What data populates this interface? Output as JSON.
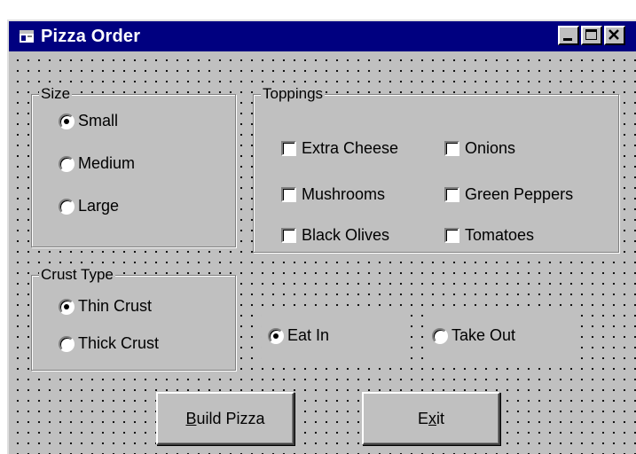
{
  "window": {
    "title": "Pizza Order",
    "icon": "form-icon",
    "controls": [
      "minimize-button",
      "maximize-button",
      "close-button"
    ]
  },
  "size_frame": {
    "label": "Size",
    "options": [
      {
        "label": "Small",
        "selected": true
      },
      {
        "label": "Medium",
        "selected": false
      },
      {
        "label": "Large",
        "selected": false
      }
    ]
  },
  "crust_frame": {
    "label": "Crust Type",
    "options": [
      {
        "label": "Thin Crust",
        "selected": true
      },
      {
        "label": "Thick Crust",
        "selected": false
      }
    ]
  },
  "toppings_frame": {
    "label": "Toppings",
    "items": [
      {
        "label": "Extra Cheese",
        "checked": false
      },
      {
        "label": "Onions",
        "checked": false
      },
      {
        "label": "Mushrooms",
        "checked": false
      },
      {
        "label": "Green Peppers",
        "checked": false
      },
      {
        "label": "Black Olives",
        "checked": false
      },
      {
        "label": "Tomatoes",
        "checked": false
      }
    ]
  },
  "where": {
    "options": [
      {
        "label": "Eat In",
        "selected": true
      },
      {
        "label": "Take Out",
        "selected": false
      }
    ]
  },
  "buttons": {
    "build": {
      "accel": "B",
      "rest": "uild Pizza"
    },
    "exit": {
      "pre": "E",
      "accel": "x",
      "post": "it"
    }
  },
  "colors": {
    "titlebar": "#000080",
    "face": "#c0c0c0"
  }
}
